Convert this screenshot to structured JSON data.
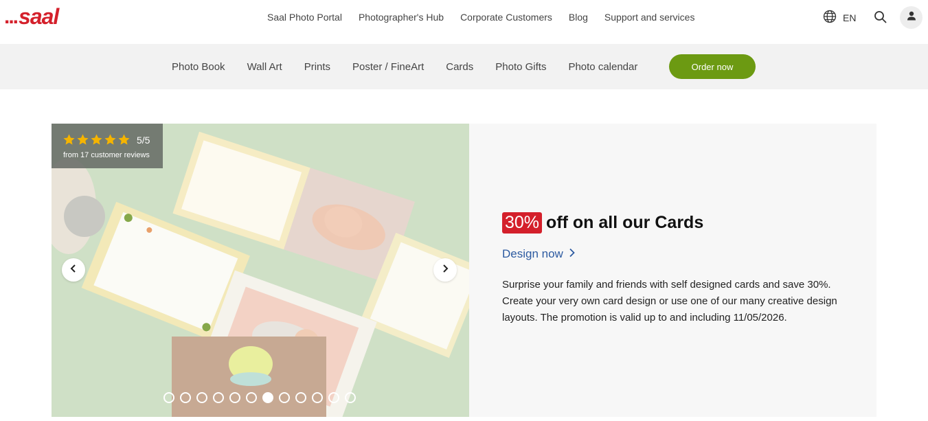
{
  "header": {
    "logo_dots": "...",
    "logo_text": "saal",
    "nav": [
      "Saal Photo Portal",
      "Photographer's Hub",
      "Corporate Customers",
      "Blog",
      "Support and services"
    ],
    "language": "EN"
  },
  "categories": {
    "items": [
      "Photo Book",
      "Wall Art",
      "Prints",
      "Poster / FineArt",
      "Cards",
      "Photo Gifts",
      "Photo calendar"
    ],
    "order_button": "Order now"
  },
  "hero": {
    "rating": {
      "score": "5/5",
      "stars": 5,
      "reviews_text": "from 17 customer reviews"
    },
    "carousel": {
      "slide_count": 12,
      "active_index": 6
    },
    "promo": {
      "badge": "30%",
      "title": "off on all our Cards",
      "link": "Design now",
      "description": "Surprise your family and friends with self designed cards and save 30%. Create your very own card design or use one of our many creative design layouts. The promotion is valid up to and including 11/05/2026."
    }
  },
  "colors": {
    "brand_red": "#d4202b",
    "order_green": "#6c9a12",
    "link_blue": "#2c5aa0",
    "star_gold": "#f5b400"
  }
}
